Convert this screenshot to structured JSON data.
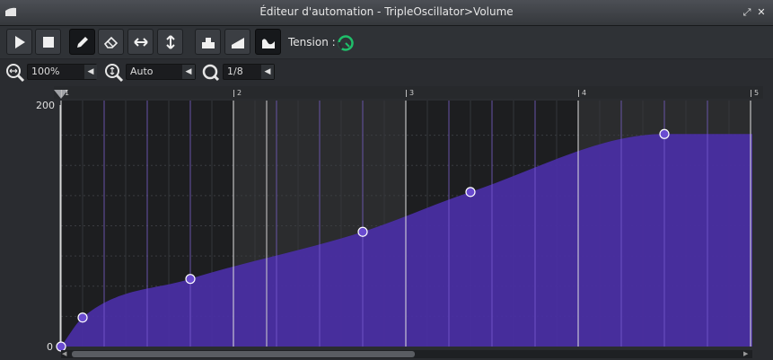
{
  "window": {
    "title": "Éditeur d'automation - TripleOscillator>Volume"
  },
  "toolbar": {
    "buttons": [
      {
        "name": "play-button",
        "icon": "play-icon",
        "active": false
      },
      {
        "name": "stop-button",
        "icon": "stop-icon",
        "active": false
      },
      {
        "name": "draw-mode-button",
        "icon": "pencil-icon",
        "active": true
      },
      {
        "name": "erase-mode-button",
        "icon": "eraser-icon",
        "active": false
      },
      {
        "name": "flip-horizontal-button",
        "icon": "horizontal-arrows-icon",
        "active": false
      },
      {
        "name": "flip-vertical-button",
        "icon": "vertical-arrows-icon",
        "active": false
      },
      {
        "name": "discrete-progression-button",
        "icon": "discrete-steps-icon",
        "active": false
      },
      {
        "name": "linear-progression-button",
        "icon": "linear-ramp-icon",
        "active": false
      },
      {
        "name": "cubic-hermite-progression-button",
        "icon": "curve-icon",
        "active": true
      }
    ],
    "tension_label": "Tension :"
  },
  "zoom": {
    "horizontal": {
      "icon": "horizontal-zoom-icon",
      "value": "100%"
    },
    "vertical": {
      "icon": "vertical-zoom-icon",
      "value": "Auto"
    },
    "quantization": {
      "icon": "quantize-icon",
      "value": "1/8"
    }
  },
  "timeline": {
    "bar_labels": [
      "1",
      "2",
      "3",
      "4",
      "5"
    ]
  },
  "editor": {
    "y_max_label": "200",
    "y_min_label": "0",
    "points": [
      {
        "bar": 1.0,
        "value": 0
      },
      {
        "bar": 1.125,
        "value": 24
      },
      {
        "bar": 1.75,
        "value": 56
      },
      {
        "bar": 2.75,
        "value": 95
      },
      {
        "bar": 3.375,
        "value": 128
      },
      {
        "bar": 4.5,
        "value": 176
      }
    ],
    "last_value_through_bar": 5.0,
    "fill_color": "#4a2fa6",
    "line_color": "#7e5fd6",
    "point_color": "#6a4bd0",
    "point_stroke": "#ffffff"
  }
}
